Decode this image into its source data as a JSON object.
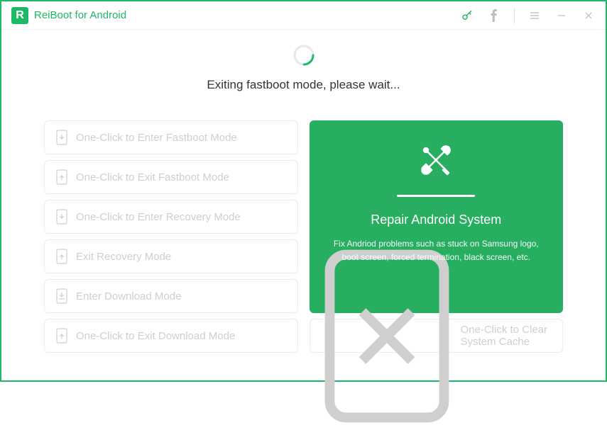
{
  "header": {
    "title": "ReiBoot for Android",
    "logo_letter": "R"
  },
  "status": {
    "message": "Exiting fastboot mode, please wait..."
  },
  "options": {
    "enter_fastboot": "One-Click to Enter Fastboot Mode",
    "exit_fastboot": "One-Click to Exit Fastboot Mode",
    "enter_recovery": "One-Click to Enter Recovery Mode",
    "exit_recovery": "Exit Recovery Mode",
    "enter_download": "Enter Download Mode",
    "exit_download": "One-Click to Exit Download Mode",
    "clear_cache": "One-Click to Clear System Cache"
  },
  "repair": {
    "title": "Repair Android System",
    "description": "Fix Andriod problems such as stuck on Samsung logo, boot screen, forced termination, black screen, etc."
  },
  "colors": {
    "primary": "#1fb866",
    "card": "#27ae60"
  }
}
